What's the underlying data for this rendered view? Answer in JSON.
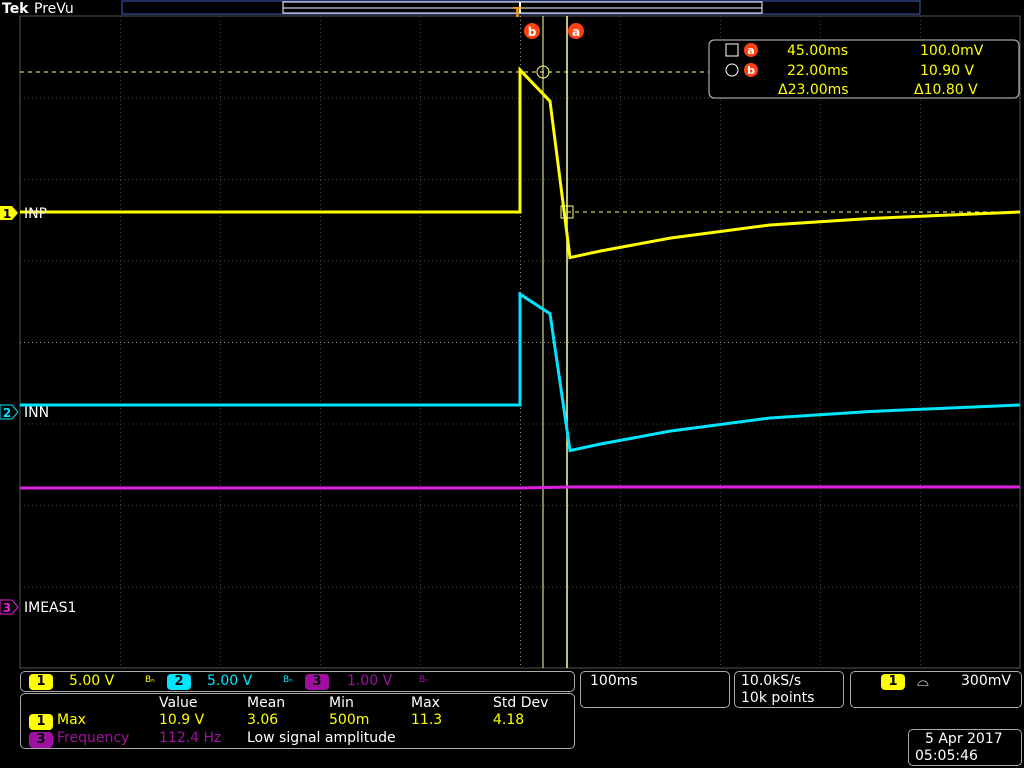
{
  "header": {
    "brand": "Tek",
    "mode": "PreVu"
  },
  "channels": [
    {
      "id": "1",
      "label": "INP",
      "color": "#ffff00"
    },
    {
      "id": "2",
      "label": "INN",
      "color": "#00e5ff"
    },
    {
      "id": "3",
      "label": "IMEAS1",
      "color": "#e020e0"
    }
  ],
  "cursors": {
    "a_marker": "a",
    "b_marker": "b",
    "a_time": "45.00ms",
    "a_value": "100.0mV",
    "b_time": "22.00ms",
    "b_value": "10.90 V",
    "delta_time": "Δ23.00ms",
    "delta_value": "Δ10.80 V"
  },
  "scales": {
    "ch1": "5.00 V",
    "ch2": "5.00 V",
    "ch3": "1.00 V",
    "bw": "Bₙ"
  },
  "timebase": "100ms",
  "acquisition": {
    "rate": "10.0kS/s",
    "points": "10k points"
  },
  "trigger": {
    "channel": "1",
    "type": "⌓",
    "level": "300mV"
  },
  "measurements": {
    "headers": [
      "Value",
      "Mean",
      "Min",
      "Max",
      "Std Dev"
    ],
    "rows": [
      {
        "ch": "1",
        "name": "Max",
        "value": "10.9 V",
        "mean": "3.06",
        "min": "500m",
        "max": "11.3",
        "std": "4.18"
      },
      {
        "ch": "3",
        "name": "Frequency",
        "value": "112.4 Hz",
        "note": "Low signal amplitude"
      }
    ]
  },
  "datetime": {
    "date": "5 Apr 2017",
    "time": "05:05:46"
  },
  "colors": {
    "ch1": "#ffff00",
    "ch2": "#00e5ff",
    "ch3": "#e020e0",
    "cursor": "#ffffaa",
    "marker": "#ff4010"
  },
  "chart_data": {
    "type": "line",
    "series": [
      {
        "name": "INP",
        "x": [
          0,
          500,
          500,
          530,
          550,
          580,
          650,
          750,
          850,
          1000
        ],
        "y": [
          0.0,
          0.0,
          10.9,
          8.5,
          -3.5,
          -3.0,
          -2.0,
          -1.0,
          -0.5,
          0.0
        ]
      },
      {
        "name": "INN",
        "x": [
          0,
          500,
          500,
          530,
          550,
          580,
          650,
          750,
          850,
          1000
        ],
        "y": [
          0.0,
          0.0,
          8.5,
          7.0,
          -3.5,
          -3.0,
          -2.0,
          -1.0,
          -0.5,
          0.0
        ]
      },
      {
        "name": "IMEAS1",
        "x": [
          0,
          500,
          550,
          1000
        ],
        "y": [
          0.0,
          0.0,
          0.1,
          0.1
        ]
      }
    ]
  }
}
